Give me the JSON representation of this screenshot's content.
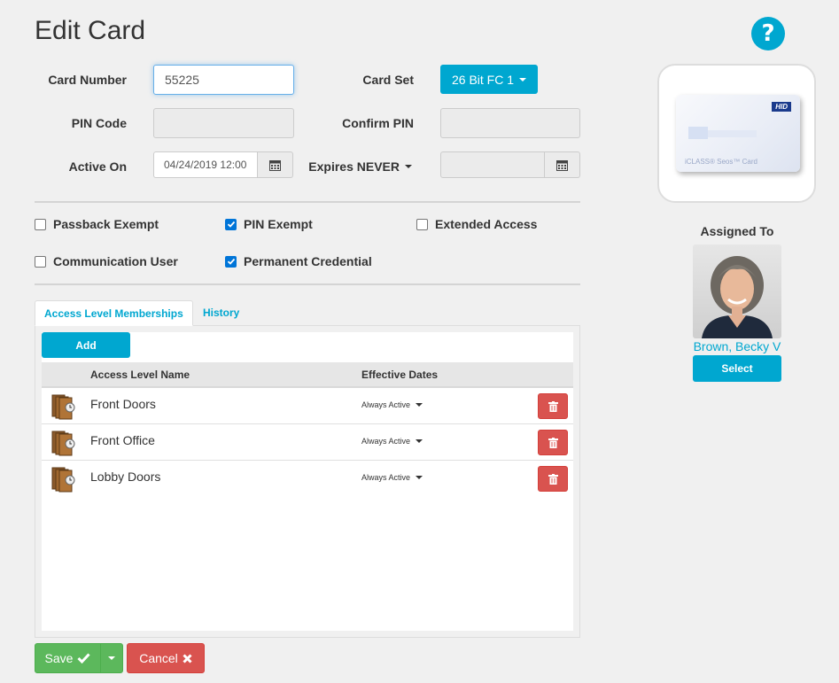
{
  "page": {
    "title": "Edit Card"
  },
  "form": {
    "card_number_label": "Card Number",
    "card_number_value": "55225",
    "card_set_label": "Card Set",
    "card_set_value": "26 Bit FC 1",
    "pin_code_label": "PIN Code",
    "confirm_pin_label": "Confirm PIN",
    "active_on_label": "Active On",
    "active_on_value": "04/24/2019 12:00",
    "expires_label": "Expires NEVER",
    "expires_value": ""
  },
  "checkboxes": [
    {
      "label": "Passback Exempt",
      "checked": false
    },
    {
      "label": "PIN Exempt",
      "checked": true
    },
    {
      "label": "Extended Access",
      "checked": false
    },
    {
      "label": "Communication User",
      "checked": false
    },
    {
      "label": "Permanent Credential",
      "checked": true
    }
  ],
  "tabs": [
    {
      "label": "Access Level Memberships",
      "active": true
    },
    {
      "label": "History",
      "active": false
    }
  ],
  "panel": {
    "add_label": "Add",
    "columns": [
      "Access Level Name",
      "Effective Dates"
    ],
    "rows": [
      {
        "name": "Front Doors",
        "dates": "Always Active",
        "icon": "door-group-icon"
      },
      {
        "name": "Front Office",
        "dates": "Always Active",
        "icon": "door-group-icon"
      },
      {
        "name": "Lobby Doors",
        "dates": "Always Active",
        "icon": "door-group-icon"
      }
    ]
  },
  "card_image": {
    "brand": "HID",
    "product": "iCLASS® Seos™ Card"
  },
  "assigned": {
    "heading": "Assigned To",
    "name": "Brown, Becky V",
    "select_label": "Select"
  },
  "actions": {
    "save_label": "Save",
    "cancel_label": "Cancel"
  },
  "colors": {
    "accent": "#00a7d0",
    "success": "#5cb85c",
    "danger": "#d9534f",
    "help": "#00a7d0"
  }
}
